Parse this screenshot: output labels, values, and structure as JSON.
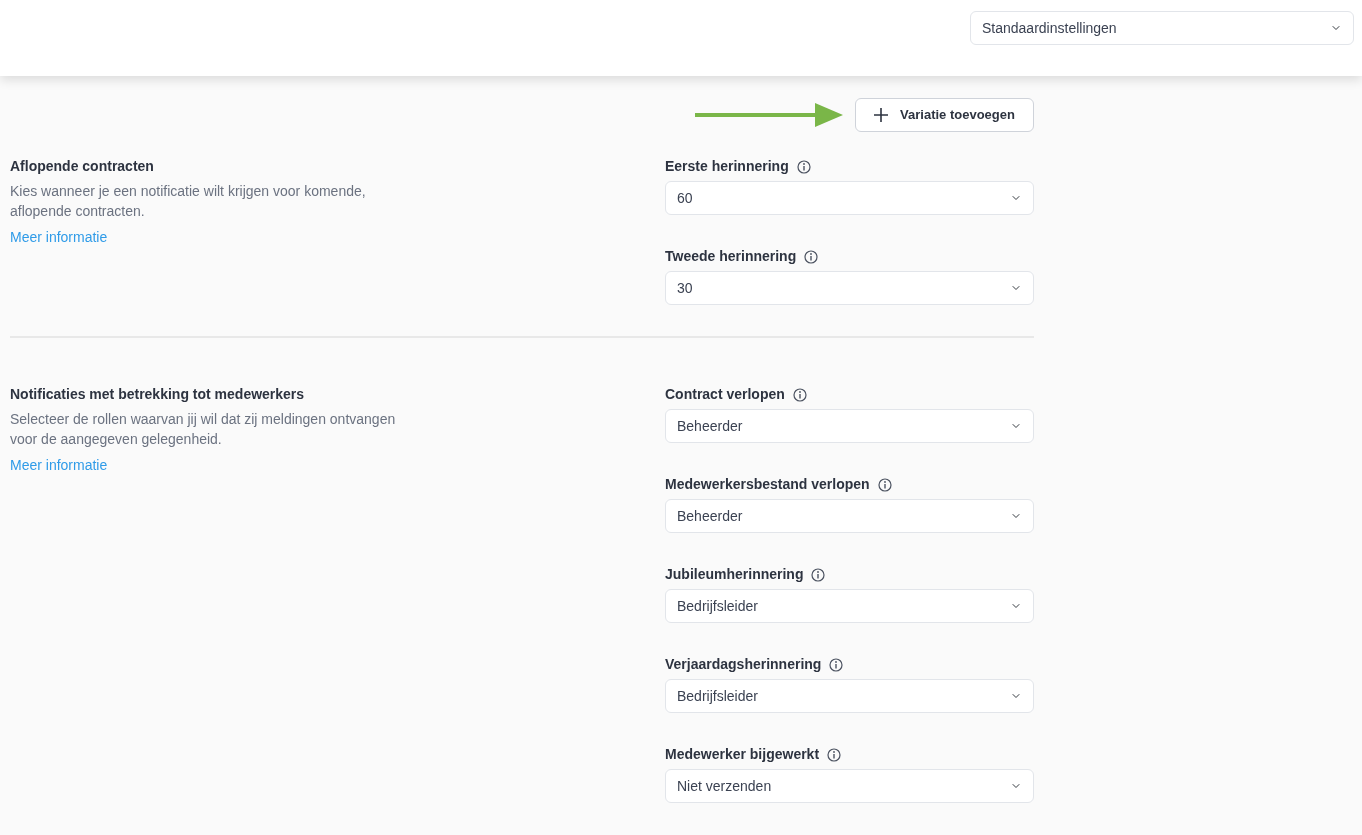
{
  "header": {
    "preset_select": {
      "value": "Standaardinstellingen"
    }
  },
  "add_button": {
    "label": "Variatie toevoegen"
  },
  "sections": [
    {
      "title": "Aflopende contracten",
      "description": "Kies wanneer je een notificatie wilt krijgen voor komende, aflopende contracten.",
      "link": "Meer informatie",
      "fields": [
        {
          "label": "Eerste herinnering",
          "value": "60"
        },
        {
          "label": "Tweede herinnering",
          "value": "30"
        }
      ]
    },
    {
      "title": "Notificaties met betrekking tot medewerkers",
      "description": "Selecteer de rollen waarvan jij wil dat zij meldingen ontvangen voor de aangegeven gelegenheid.",
      "link": "Meer informatie",
      "fields": [
        {
          "label": "Contract verlopen",
          "value": "Beheerder"
        },
        {
          "label": "Medewerkersbestand verlopen",
          "value": "Beheerder"
        },
        {
          "label": "Jubileumherinnering",
          "value": "Bedrijfsleider"
        },
        {
          "label": "Verjaardagsherinnering",
          "value": "Bedrijfsleider"
        },
        {
          "label": "Medewerker bijgewerkt",
          "value": "Niet verzenden"
        }
      ]
    }
  ]
}
